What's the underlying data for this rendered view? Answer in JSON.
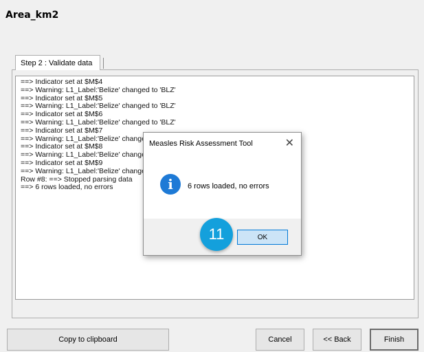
{
  "window": {
    "title": "Area_km2"
  },
  "tabs": [
    {
      "label": "Step 2 : Validate data"
    }
  ],
  "log_lines": [
    "==> Indicator set at $M$4",
    "==> Warning: L1_Label:'Belize' changed to 'BLZ'",
    "==> Indicator set at $M$5",
    "==> Warning: L1_Label:'Belize' changed to 'BLZ'",
    "==> Indicator set at $M$6",
    "==> Warning: L1_Label:'Belize' changed to 'BLZ'",
    "==> Indicator set at $M$7",
    "==> Warning: L1_Label:'Belize' changed to 'BLZ'",
    "==> Indicator set at $M$8",
    "==> Warning: L1_Label:'Belize' changed to 'BLZ'",
    "==> Indicator set at $M$9",
    "==> Warning: L1_Label:'Belize' changed to 'BLZ'",
    "Row #8: ==> Stopped parsing data",
    "==> 6 rows loaded, no errors"
  ],
  "buttons": {
    "copy": "Copy to clipboard",
    "cancel": "Cancel",
    "back": "<< Back",
    "finish": "Finish"
  },
  "dialog": {
    "title": "Measles Risk Assessment Tool",
    "close": "✕",
    "icon": "info-icon",
    "message": "6 rows loaded, no errors",
    "ok": "OK"
  },
  "step_badge": "11",
  "colors": {
    "accent": "#0078d7",
    "badge": "#14a0dc",
    "info": "#1e7ad6"
  }
}
